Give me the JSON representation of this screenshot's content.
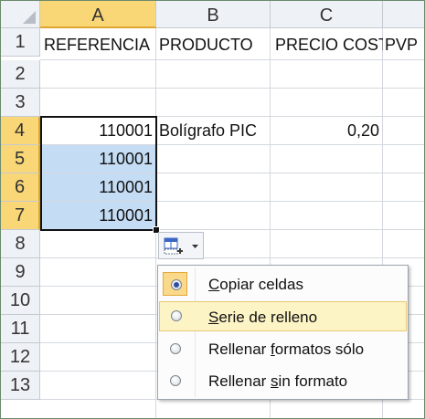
{
  "columns": [
    "A",
    "B",
    "C",
    ""
  ],
  "rows": [
    "1",
    "2",
    "3",
    "4",
    "5",
    "6",
    "7",
    "8",
    "9",
    "10",
    "11",
    "12",
    "13"
  ],
  "cells": {
    "a1": "REFERENCIA",
    "b1": "PRODUCTO",
    "c1": "PRECIO COSTO",
    "d1": "PVP",
    "a4": "110001",
    "b4": "Bolígrafo PIC",
    "c4": "0,20",
    "a5": "110001",
    "a6": "110001",
    "a7": "110001"
  },
  "autofill": {
    "icon": "autofill-options-icon",
    "dropdown_icon": "caret-down-icon"
  },
  "menu": {
    "items": [
      {
        "accel": "C",
        "rest": "opiar celdas",
        "state": "selected"
      },
      {
        "accel": "S",
        "rest": "erie de relleno",
        "state": "hover"
      },
      {
        "pre": "Rellenar ",
        "accel": "f",
        "rest": "ormatos sólo"
      },
      {
        "pre": "Rellenar ",
        "accel": "s",
        "rest": "in formato"
      }
    ]
  },
  "colors": {
    "header_bg": "#eef1f5",
    "header_selected": "#f9d777",
    "selection_fill": "#c5dcf5",
    "menu_hover": "#fdf4c5"
  }
}
